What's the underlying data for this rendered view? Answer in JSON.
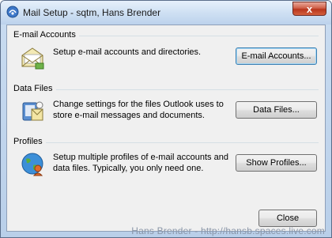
{
  "window": {
    "title": "Mail Setup - sqtm, Hans Brender",
    "close_glyph": "x"
  },
  "email_accounts": {
    "heading": "E-mail Accounts",
    "description": "Setup e-mail accounts and directories.",
    "button_label": "E-mail Accounts...",
    "icon": "email-envelope-icon"
  },
  "data_files": {
    "heading": "Data Files",
    "description": "Change settings for the files Outlook uses to store e-mail messages and documents.",
    "button_label": "Data Files...",
    "icon": "data-files-icon"
  },
  "profiles": {
    "heading": "Profiles",
    "description": "Setup multiple profiles of e-mail accounts and data files. Typically, you only need one.",
    "button_label": "Show Profiles...",
    "icon": "profiles-globe-icon"
  },
  "footer": {
    "close_label": "Close"
  },
  "watermark": "Hans Brender - http://hansb.spaces.live.com"
}
